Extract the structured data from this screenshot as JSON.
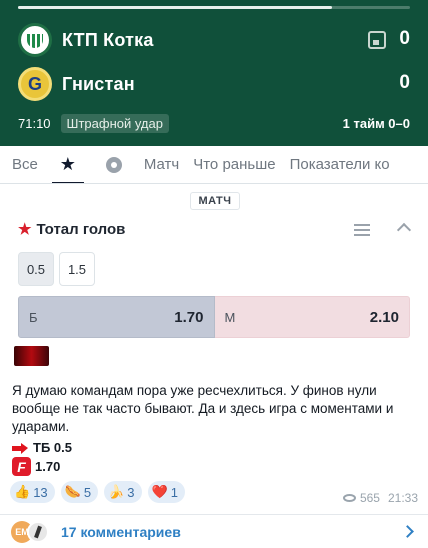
{
  "progress": {
    "fraction": 0.8
  },
  "home": {
    "name": "КТП Котка",
    "score": "0"
  },
  "away": {
    "name": "Гнистан",
    "score": "0"
  },
  "status": {
    "time": "71:10",
    "event": "Штрафной удар",
    "half": "1 тайм 0–0"
  },
  "tabs": [
    "Все",
    "",
    "",
    "Матч",
    "Что раньше",
    "Показатели ко"
  ],
  "section_label": "МАТЧ",
  "market": {
    "title": "Тотал голов",
    "lines": [
      "0.5",
      "1.5"
    ],
    "selected_line": "0.5",
    "over": {
      "label": "Б",
      "odd": "1.70"
    },
    "under": {
      "label": "М",
      "odd": "2.10"
    }
  },
  "post": {
    "text": "Я думаю командам пора уже ресчехлиться. У финов нули вообще не так часто бывают. Да и здесь игра с моментами и ударами.",
    "pick": "ТБ 0.5",
    "odd": "1.70"
  },
  "reactions": [
    {
      "emoji": "👍",
      "count": "13"
    },
    {
      "emoji": "🌭",
      "count": "5"
    },
    {
      "emoji": "🍌",
      "count": "3"
    },
    {
      "emoji": "❤️",
      "count": "1"
    }
  ],
  "views": "565",
  "time": "21:33",
  "comments": {
    "avatar_text": "EM",
    "label": "17 комментариев"
  },
  "colors": {
    "header_bg": "#10503a",
    "accent": "#d9202c",
    "link": "#2f80c4"
  }
}
